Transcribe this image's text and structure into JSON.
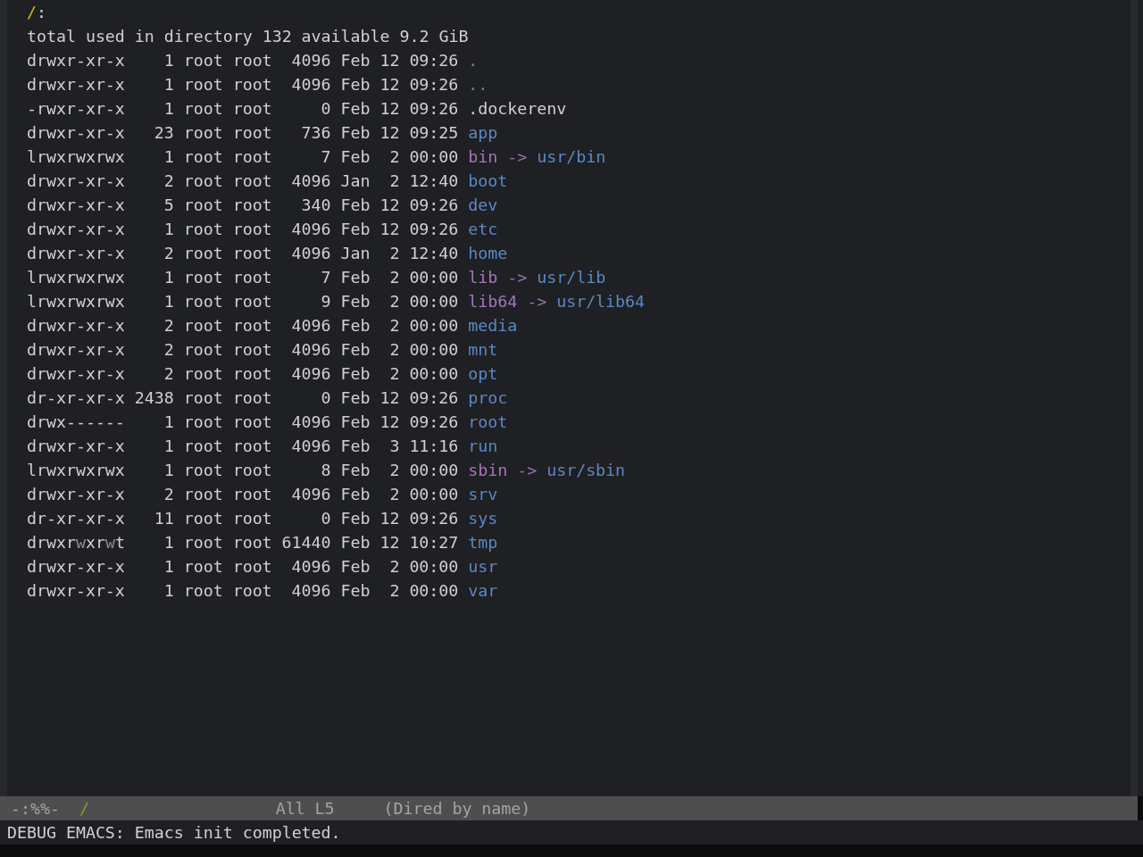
{
  "buffer": {
    "header": {
      "path": "/",
      "suffix": ":"
    },
    "summary": "total used in directory 132 available 9.2 GiB",
    "rows": [
      {
        "mode": [
          {
            "text": "drwxr-xr-x",
            "dim": false
          }
        ],
        "links": "1",
        "owner": "root",
        "group": "root",
        "size": "4096",
        "month": "Feb",
        "day": "12",
        "time": "09:26",
        "name": ".",
        "kind": "dir"
      },
      {
        "mode": [
          {
            "text": "drwxr-xr-x",
            "dim": false
          }
        ],
        "links": "1",
        "owner": "root",
        "group": "root",
        "size": "4096",
        "month": "Feb",
        "day": "12",
        "time": "09:26",
        "name": "..",
        "kind": "dir"
      },
      {
        "mode": [
          {
            "text": "-rwxr-xr-x",
            "dim": false
          }
        ],
        "links": "1",
        "owner": "root",
        "group": "root",
        "size": "0",
        "month": "Feb",
        "day": "12",
        "time": "09:26",
        "name": ".dockerenv",
        "kind": "file"
      },
      {
        "mode": [
          {
            "text": "drwxr-xr-x",
            "dim": false
          }
        ],
        "links": "23",
        "owner": "root",
        "group": "root",
        "size": "736",
        "month": "Feb",
        "day": "12",
        "time": "09:25",
        "name": "app",
        "kind": "dir"
      },
      {
        "mode": [
          {
            "text": "lrwxrwxrwx",
            "dim": false
          }
        ],
        "links": "1",
        "owner": "root",
        "group": "root",
        "size": "7",
        "month": "Feb",
        "day": "2",
        "time": "00:00",
        "name": "bin",
        "kind": "symlink",
        "arrow": "->",
        "target": "usr/bin"
      },
      {
        "mode": [
          {
            "text": "drwxr-xr-x",
            "dim": false
          }
        ],
        "links": "2",
        "owner": "root",
        "group": "root",
        "size": "4096",
        "month": "Jan",
        "day": "2",
        "time": "12:40",
        "name": "boot",
        "kind": "dir"
      },
      {
        "mode": [
          {
            "text": "drwxr-xr-x",
            "dim": false
          }
        ],
        "links": "5",
        "owner": "root",
        "group": "root",
        "size": "340",
        "month": "Feb",
        "day": "12",
        "time": "09:26",
        "name": "dev",
        "kind": "dir"
      },
      {
        "mode": [
          {
            "text": "drwxr-xr-x",
            "dim": false
          }
        ],
        "links": "1",
        "owner": "root",
        "group": "root",
        "size": "4096",
        "month": "Feb",
        "day": "12",
        "time": "09:26",
        "name": "etc",
        "kind": "dir"
      },
      {
        "mode": [
          {
            "text": "drwxr-xr-x",
            "dim": false
          }
        ],
        "links": "2",
        "owner": "root",
        "group": "root",
        "size": "4096",
        "month": "Jan",
        "day": "2",
        "time": "12:40",
        "name": "home",
        "kind": "dir"
      },
      {
        "mode": [
          {
            "text": "lrwxrwxrwx",
            "dim": false
          }
        ],
        "links": "1",
        "owner": "root",
        "group": "root",
        "size": "7",
        "month": "Feb",
        "day": "2",
        "time": "00:00",
        "name": "lib",
        "kind": "symlink",
        "arrow": "->",
        "target": "usr/lib"
      },
      {
        "mode": [
          {
            "text": "lrwxrwxrwx",
            "dim": false
          }
        ],
        "links": "1",
        "owner": "root",
        "group": "root",
        "size": "9",
        "month": "Feb",
        "day": "2",
        "time": "00:00",
        "name": "lib64",
        "kind": "symlink",
        "arrow": "->",
        "target": "usr/lib64"
      },
      {
        "mode": [
          {
            "text": "drwxr-xr-x",
            "dim": false
          }
        ],
        "links": "2",
        "owner": "root",
        "group": "root",
        "size": "4096",
        "month": "Feb",
        "day": "2",
        "time": "00:00",
        "name": "media",
        "kind": "dir"
      },
      {
        "mode": [
          {
            "text": "drwxr-xr-x",
            "dim": false
          }
        ],
        "links": "2",
        "owner": "root",
        "group": "root",
        "size": "4096",
        "month": "Feb",
        "day": "2",
        "time": "00:00",
        "name": "mnt",
        "kind": "dir"
      },
      {
        "mode": [
          {
            "text": "drwxr-xr-x",
            "dim": false
          }
        ],
        "links": "2",
        "owner": "root",
        "group": "root",
        "size": "4096",
        "month": "Feb",
        "day": "2",
        "time": "00:00",
        "name": "opt",
        "kind": "dir"
      },
      {
        "mode": [
          {
            "text": "dr-xr-xr-x",
            "dim": false
          }
        ],
        "links": "2438",
        "owner": "root",
        "group": "root",
        "size": "0",
        "month": "Feb",
        "day": "12",
        "time": "09:26",
        "name": "proc",
        "kind": "dir"
      },
      {
        "mode": [
          {
            "text": "drwx------",
            "dim": false
          }
        ],
        "links": "1",
        "owner": "root",
        "group": "root",
        "size": "4096",
        "month": "Feb",
        "day": "12",
        "time": "09:26",
        "name": "root",
        "kind": "dir"
      },
      {
        "mode": [
          {
            "text": "drwxr-xr-x",
            "dim": false
          }
        ],
        "links": "1",
        "owner": "root",
        "group": "root",
        "size": "4096",
        "month": "Feb",
        "day": "3",
        "time": "11:16",
        "name": "run",
        "kind": "dir"
      },
      {
        "mode": [
          {
            "text": "lrwxrwxrwx",
            "dim": false
          }
        ],
        "links": "1",
        "owner": "root",
        "group": "root",
        "size": "8",
        "month": "Feb",
        "day": "2",
        "time": "00:00",
        "name": "sbin",
        "kind": "symlink",
        "arrow": "->",
        "target": "usr/sbin"
      },
      {
        "mode": [
          {
            "text": "drwxr-xr-x",
            "dim": false
          }
        ],
        "links": "2",
        "owner": "root",
        "group": "root",
        "size": "4096",
        "month": "Feb",
        "day": "2",
        "time": "00:00",
        "name": "srv",
        "kind": "dir"
      },
      {
        "mode": [
          {
            "text": "dr-xr-xr-x",
            "dim": false
          }
        ],
        "links": "11",
        "owner": "root",
        "group": "root",
        "size": "0",
        "month": "Feb",
        "day": "12",
        "time": "09:26",
        "name": "sys",
        "kind": "dir"
      },
      {
        "mode": [
          {
            "text": "drwxr",
            "dim": false
          },
          {
            "text": "w",
            "dim": true
          },
          {
            "text": "xr",
            "dim": false
          },
          {
            "text": "w",
            "dim": true
          },
          {
            "text": "t",
            "dim": false
          }
        ],
        "links": "1",
        "owner": "root",
        "group": "root",
        "size": "61440",
        "month": "Feb",
        "day": "12",
        "time": "10:27",
        "name": "tmp",
        "kind": "dir"
      },
      {
        "mode": [
          {
            "text": "drwxr-xr-x",
            "dim": false
          }
        ],
        "links": "1",
        "owner": "root",
        "group": "root",
        "size": "4096",
        "month": "Feb",
        "day": "2",
        "time": "00:00",
        "name": "usr",
        "kind": "dir"
      },
      {
        "mode": [
          {
            "text": "drwxr-xr-x",
            "dim": false
          }
        ],
        "links": "1",
        "owner": "root",
        "group": "root",
        "size": "4096",
        "month": "Feb",
        "day": "2",
        "time": "00:00",
        "name": "var",
        "kind": "dir"
      }
    ]
  },
  "mode_line": {
    "status": "-:%%-",
    "buffer_name": "/",
    "position": "All L5",
    "major_mode": "(Dired by name)"
  },
  "echo_area": {
    "message": "DEBUG EMACS: Emacs init completed."
  }
}
